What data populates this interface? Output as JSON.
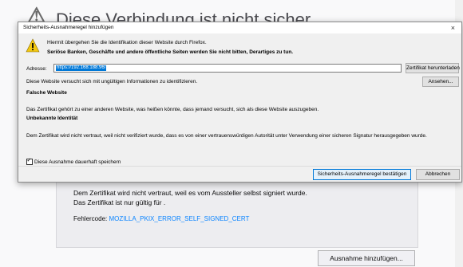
{
  "background": {
    "title": "Diese Verbindung ist nicht sicher",
    "text_line1": "Dem Zertifikat wird nicht vertraut, weil es vom Aussteller selbst signiert wurde.",
    "text_line2": "Das Zertifikat ist nur gültig für .",
    "error_label": "Fehlercode:",
    "error_code": "MOZILLA_PKIX_ERROR_SELF_SIGNED_CERT",
    "add_exception_label": "Ausnahme hinzufügen..."
  },
  "dialog": {
    "title": "Sicherheits-Ausnahmeregel hinzufügen",
    "intro": "Hiermit übergehen Sie die Identifikation dieser Website durch Firefox.",
    "intro_bold": "Seriöse Banken, Geschäfte und andere öffentliche Seiten werden Sie nicht bitten, Derartiges zu tun.",
    "address_label": "Adresse:",
    "address_value": "https://192.168.188.96/",
    "download_cert_label": "Zertifikat herunterladen",
    "view_label": "Ansehen...",
    "line_invalid": "Diese Website versucht sich mit ungültigen Informationen zu identifizieren.",
    "heading_wrong_site": "Falsche Website",
    "line_wrong_site": "Das Zertifikat gehört zu einer anderen Website, was heißen könnte, dass jemand versucht, sich als diese Website auszugeben.",
    "heading_unknown": "Unbekannte Identität",
    "line_unknown": "Dem Zertifikat wird nicht vertraut, weil nicht verifiziert wurde, dass es von einer vertrauenswürdigen Autorität unter Verwendung einer sicheren Signatur herausgegeben wurde.",
    "permanent_label": "Diese Ausnahme dauerhaft speichern",
    "permanent_checked": true,
    "confirm_label": "Sicherheits-Ausnahmeregel bestätigen",
    "cancel_label": "Abbrechen",
    "close_glyph": "×"
  },
  "colors": {
    "accent": "#0078d7",
    "link": "#0a84ff",
    "warning": "#f2c811"
  }
}
